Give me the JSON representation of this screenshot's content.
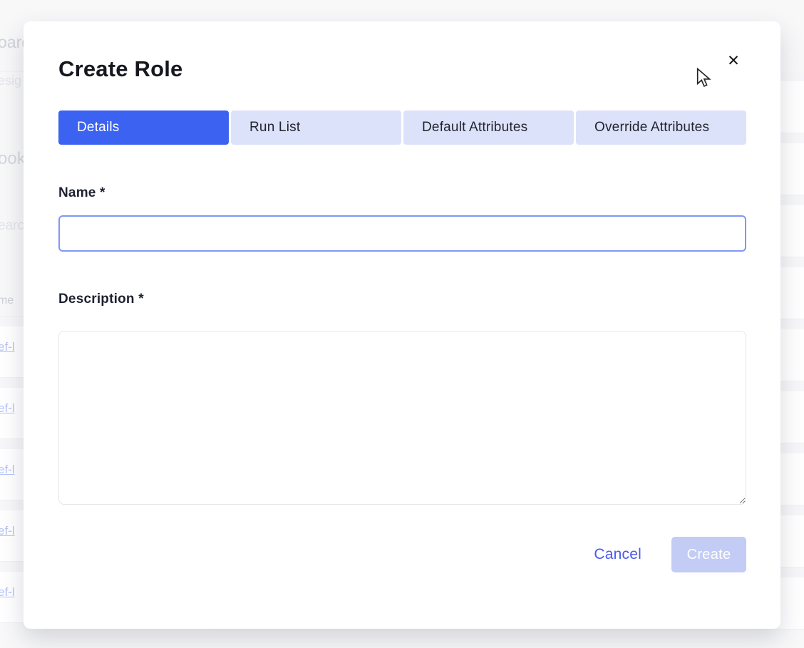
{
  "colors": {
    "accent_blue": "#3c62f1",
    "tab_inactive_bg": "#dde2fb",
    "name_input_border": "#8097f3",
    "textarea_border": "#e3e7e7",
    "cancel_text": "#4a5ae9",
    "create_disabled_bg": "#c3ccf4",
    "link_blue": "#3f62ee"
  },
  "modal": {
    "title": "Create Role",
    "close_icon": "✕",
    "tabs": [
      {
        "label": "Details",
        "active": true
      },
      {
        "label": "Run List",
        "active": false
      },
      {
        "label": "Default Attributes",
        "active": false
      },
      {
        "label": "Override Attributes",
        "active": false
      }
    ],
    "fields": {
      "name": {
        "label": "Name *",
        "value": ""
      },
      "description": {
        "label": "Description *",
        "value": ""
      }
    },
    "actions": {
      "cancel_label": "Cancel",
      "create_label": "Create",
      "create_disabled": true
    }
  },
  "background": {
    "fragments": [
      {
        "text": "oard"
      },
      {
        "text": "esig"
      },
      {
        "text": "ook"
      },
      {
        "text": "earc"
      },
      {
        "text": "me"
      }
    ],
    "rows": [
      {
        "link": "ef-l"
      },
      {
        "link": "ef-l"
      },
      {
        "link": "ef-l"
      },
      {
        "link": "ef-l"
      },
      {
        "link": "ef-l"
      }
    ]
  }
}
